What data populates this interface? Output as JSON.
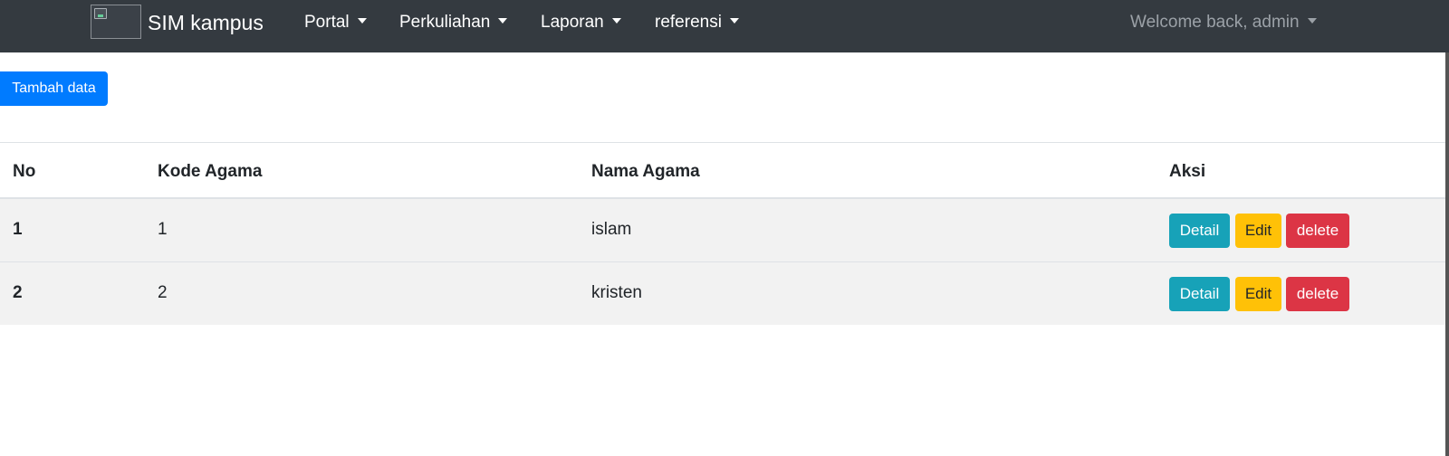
{
  "navbar": {
    "brand": "SIM kampus",
    "menus": [
      "Portal",
      "Perkuliahan",
      "Laporan",
      "referensi"
    ],
    "user": "Welcome back, admin"
  },
  "actions": {
    "add_label": "Tambah data"
  },
  "table": {
    "headers": [
      "No",
      "Kode Agama",
      "Nama Agama",
      "Aksi"
    ],
    "rows": [
      {
        "no": "1",
        "kode": "1",
        "nama": "islam"
      },
      {
        "no": "2",
        "kode": "2",
        "nama": "kristen"
      }
    ],
    "buttons": {
      "detail": "Detail",
      "edit": "Edit",
      "delete": "delete"
    }
  },
  "colors": {
    "navbar_bg": "#343a40",
    "primary": "#007bff",
    "info": "#17a2b8",
    "warning": "#ffc107",
    "danger": "#dc3545",
    "row_stripe": "#f2f2f2"
  }
}
